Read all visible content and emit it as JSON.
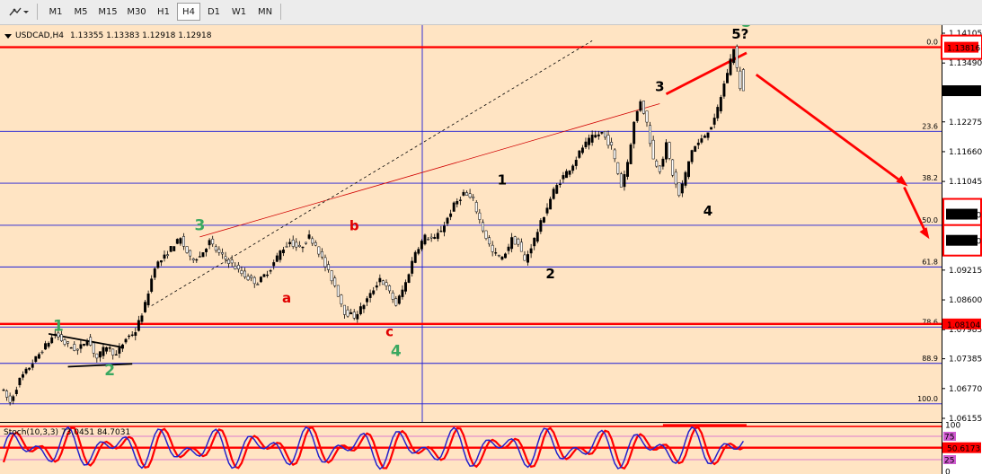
{
  "toolbar": {
    "timeframes": [
      "M1",
      "M5",
      "M15",
      "M30",
      "H1",
      "H4",
      "D1",
      "W1",
      "MN"
    ],
    "active": "H4"
  },
  "header": {
    "symbol": "USDCAD,H4",
    "ohlc": "1.13355 1.13383 1.12918 1.12918"
  },
  "oscillator": {
    "label": "Stoch(10,3,3) 73.0451 84.7031"
  },
  "chart_data": {
    "type": "candlestick",
    "symbol": "USDCAD",
    "timeframe": "H4",
    "y_axis_ticks": [
      "1.14105",
      "1.13490",
      "1.12275",
      "1.11660",
      "1.11045",
      "1.10430",
      "1.09215",
      "1.08600",
      "1.07985",
      "1.07385",
      "1.06770",
      "1.06155"
    ],
    "current_price": "1.12918",
    "price_tags": [
      {
        "text": "1.13816",
        "color": "#ff0000"
      },
      {
        "text": "1.12918",
        "color": "#000000"
      },
      {
        "text": "1.08104",
        "color": "#ff0000"
      },
      {
        "text": "1.10430",
        "color": "#ffffff",
        "boxed": true
      },
      {
        "text": "1.09830",
        "color": "#ffffff",
        "boxed": true
      }
    ],
    "fib_levels": [
      {
        "label": "0.0",
        "price": 1.13816
      },
      {
        "label": "23.6",
        "price": 1.1208
      },
      {
        "label": "38.2",
        "price": 1.1101
      },
      {
        "label": "50.0",
        "price": 1.1014
      },
      {
        "label": "61.8",
        "price": 1.0928
      },
      {
        "label": "78.6",
        "price": 1.0804
      },
      {
        "label": "88.9",
        "price": 1.0729
      },
      {
        "label": "100.0",
        "price": 1.06455
      }
    ],
    "horizontal_lines": [
      1.13816,
      1.08104
    ],
    "price_path": [
      [
        0,
        1.068
      ],
      [
        3,
        1.0648
      ],
      [
        6,
        1.0695
      ],
      [
        10,
        1.073
      ],
      [
        14,
        1.0765
      ],
      [
        17,
        1.079
      ],
      [
        20,
        1.077
      ],
      [
        24,
        1.0755
      ],
      [
        27,
        1.078
      ],
      [
        30,
        1.074
      ],
      [
        33,
        1.0765
      ],
      [
        36,
        1.0745
      ],
      [
        39,
        1.078
      ],
      [
        42,
        1.0795
      ],
      [
        45,
        1.085
      ],
      [
        48,
        1.093
      ],
      [
        51,
        1.0948
      ],
      [
        54,
        1.0975
      ],
      [
        56,
        1.0985
      ],
      [
        59,
        1.0945
      ],
      [
        62,
        1.095
      ],
      [
        65,
        1.098
      ],
      [
        68,
        1.0955
      ],
      [
        71,
        1.094
      ],
      [
        74,
        1.092
      ],
      [
        77,
        1.0905
      ],
      [
        80,
        1.0895
      ],
      [
        84,
        1.0925
      ],
      [
        87,
        1.096
      ],
      [
        90,
        1.098
      ],
      [
        93,
        1.0965
      ],
      [
        96,
        1.099
      ],
      [
        98,
        1.0975
      ],
      [
        101,
        1.093
      ],
      [
        104,
        1.089
      ],
      [
        107,
        1.0835
      ],
      [
        110,
        1.0826
      ],
      [
        112,
        1.0842
      ],
      [
        115,
        1.087
      ],
      [
        118,
        1.0905
      ],
      [
        121,
        1.0875
      ],
      [
        123,
        1.085
      ],
      [
        126,
        1.0895
      ],
      [
        129,
        1.096
      ],
      [
        132,
        1.099
      ],
      [
        135,
        1.0985
      ],
      [
        138,
        1.1015
      ],
      [
        141,
        1.1055
      ],
      [
        144,
        1.108
      ],
      [
        147,
        1.1065
      ],
      [
        150,
        1.1005
      ],
      [
        153,
        1.0958
      ],
      [
        156,
        1.0945
      ],
      [
        159,
        1.0985
      ],
      [
        161,
        1.0975
      ],
      [
        163,
        1.094
      ],
      [
        166,
        1.0985
      ],
      [
        169,
        1.1035
      ],
      [
        172,
        1.1085
      ],
      [
        175,
        1.1115
      ],
      [
        178,
        1.114
      ],
      [
        181,
        1.1175
      ],
      [
        184,
        1.1195
      ],
      [
        187,
        1.1205
      ],
      [
        190,
        1.1175
      ],
      [
        193,
        1.1095
      ],
      [
        195,
        1.1145
      ],
      [
        197,
        1.1225
      ],
      [
        199,
        1.1272
      ],
      [
        201,
        1.1225
      ],
      [
        203,
        1.115
      ],
      [
        205,
        1.113
      ],
      [
        207,
        1.118
      ],
      [
        209,
        1.112
      ],
      [
        211,
        1.1075
      ],
      [
        213,
        1.112
      ],
      [
        215,
        1.117
      ],
      [
        218,
        1.119
      ],
      [
        220,
        1.121
      ],
      [
        222,
        1.123
      ],
      [
        224,
        1.128
      ],
      [
        226,
        1.133
      ],
      [
        228,
        1.1381
      ],
      [
        229,
        1.1338
      ],
      [
        230,
        1.1292
      ]
    ],
    "wave_labels": [
      {
        "text": "1",
        "color": "green",
        "bar": 17,
        "price": 1.0778,
        "pos": "above"
      },
      {
        "text": "2",
        "color": "green",
        "bar": 33,
        "price": 1.0745,
        "pos": "below"
      },
      {
        "text": "3",
        "color": "green",
        "bar": 61,
        "price": 1.0985,
        "pos": "above"
      },
      {
        "text": "a",
        "color": "red",
        "bar": 88,
        "price": 1.0895,
        "pos": "below"
      },
      {
        "text": "b",
        "color": "red",
        "bar": 109,
        "price": 1.0985,
        "pos": "above"
      },
      {
        "text": "c",
        "color": "red",
        "bar": 120,
        "price": 1.0826,
        "pos": "below"
      },
      {
        "text": "4",
        "color": "green",
        "bar": 122,
        "price": 1.0826,
        "pos": "below2"
      },
      {
        "text": "1",
        "color": "black",
        "bar": 155,
        "price": 1.108,
        "pos": "above"
      },
      {
        "text": "2",
        "color": "black",
        "bar": 170,
        "price": 1.0945,
        "pos": "below"
      },
      {
        "text": "3",
        "color": "black",
        "bar": 204,
        "price": 1.1272,
        "pos": "above"
      },
      {
        "text": "4",
        "color": "black",
        "bar": 219,
        "price": 1.1075,
        "pos": "below"
      },
      {
        "text": "5?",
        "color": "black",
        "bar": 229,
        "price": 1.1381,
        "pos": "above"
      },
      {
        "text": "5",
        "color": "green",
        "bar": 231,
        "price": 1.1381,
        "pos": "above2"
      }
    ],
    "stochastic": {
      "k": 73.0451,
      "d": 84.7031,
      "levels_right": [
        "100",
        "75",
        "50.6173",
        "25",
        "0"
      ]
    }
  }
}
